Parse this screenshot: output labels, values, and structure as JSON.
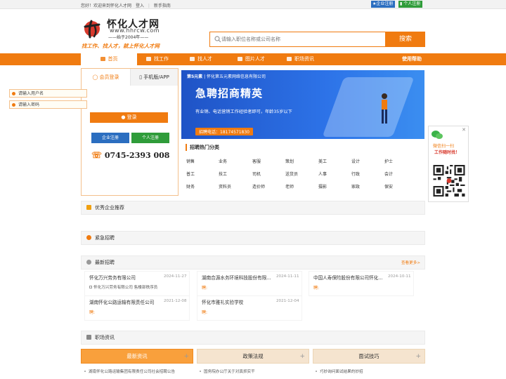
{
  "topbar": {
    "greeting": "您好！欢迎来到怀化人才网",
    "login": "登入",
    "newbie": "新手指南",
    "ent_register": "企业注册",
    "per_register": "个人注册"
  },
  "logo": {
    "name": "怀化人才网",
    "url": "www.hhrcw.com",
    "since": "——始于2004年——",
    "slogan": "找工作、找人才，就上怀化人才网"
  },
  "search": {
    "placeholder": "请输入职位名称或公司名称",
    "button": "搜索"
  },
  "nav": {
    "items": [
      "首页",
      "找工作",
      "找人才",
      "图片人才",
      "职场资讯"
    ],
    "help": "使用帮助"
  },
  "login": {
    "tab_member": "会员登录",
    "tab_app": "手机版/APP",
    "username_placeholder": "请输入用户名",
    "password_placeholder": "请输入密码",
    "login_button": "登录",
    "ent_register": "企业注册",
    "per_register": "个人注册",
    "phone": "0745-2393 008"
  },
  "banner": {
    "brand": "怀化第五元素网络信息有限公司",
    "brand_logo": "第5元素",
    "title": "急聘招商精英",
    "desc": "有业销、电话营销工作经验者即可，年龄35岁以下",
    "phone": "招聘电话：18174571830"
  },
  "categories": {
    "title": "招聘热门分类",
    "items": [
      "销售",
      "业务",
      "客服",
      "策划",
      "美工",
      "设计",
      "护士",
      "普工",
      "技工",
      "司机",
      "送货员",
      "人事",
      "行政",
      "会计",
      "财务",
      "资料员",
      "造价师",
      "老师",
      "摄影",
      "家政",
      "保安"
    ]
  },
  "qr": {
    "close": "✕",
    "line1": "微信扫一扫",
    "line2": "工作随时找！"
  },
  "sections": {
    "famous": "优秀企业推荐",
    "urgent": "紧急招聘",
    "latest": "最新招聘",
    "more": "查看更多>",
    "news": "职场资讯"
  },
  "jobs": [
    {
      "company": "怀化万兴劳务有限公司",
      "date": "2024-11-27",
      "jobs": "怀化万兴劳务有限公司  售楼部秩序员"
    },
    {
      "company": "湖南合源水务环境科技股份有限...",
      "date": "2024-11-11",
      "jobs": "聘:"
    },
    {
      "company": "中国人寿保险股份有限公司怀化...",
      "date": "2024-10-11",
      "jobs": "聘:"
    },
    {
      "company": "湖南怀化公路运输有限责任公司",
      "date": "2021-12-08",
      "jobs": "聘:"
    },
    {
      "company": "怀化市雅礼实验学校",
      "date": "2021-12-04",
      "jobs": "聘:"
    }
  ],
  "news": {
    "tabs": [
      "最新资讯",
      "政策法规",
      "面试技巧"
    ],
    "col1": [
      "湖南怀化公路运输集团有限责任公司社会招聘公告"
    ],
    "col2": [
      "国务院办公厅关于对真抓实干"
    ],
    "col3": [
      "巧妙询问面试结果的妙招"
    ]
  },
  "colors": {
    "accent": "#f07b10",
    "blue": "#2b6ec0",
    "green": "#2f9c3a"
  }
}
